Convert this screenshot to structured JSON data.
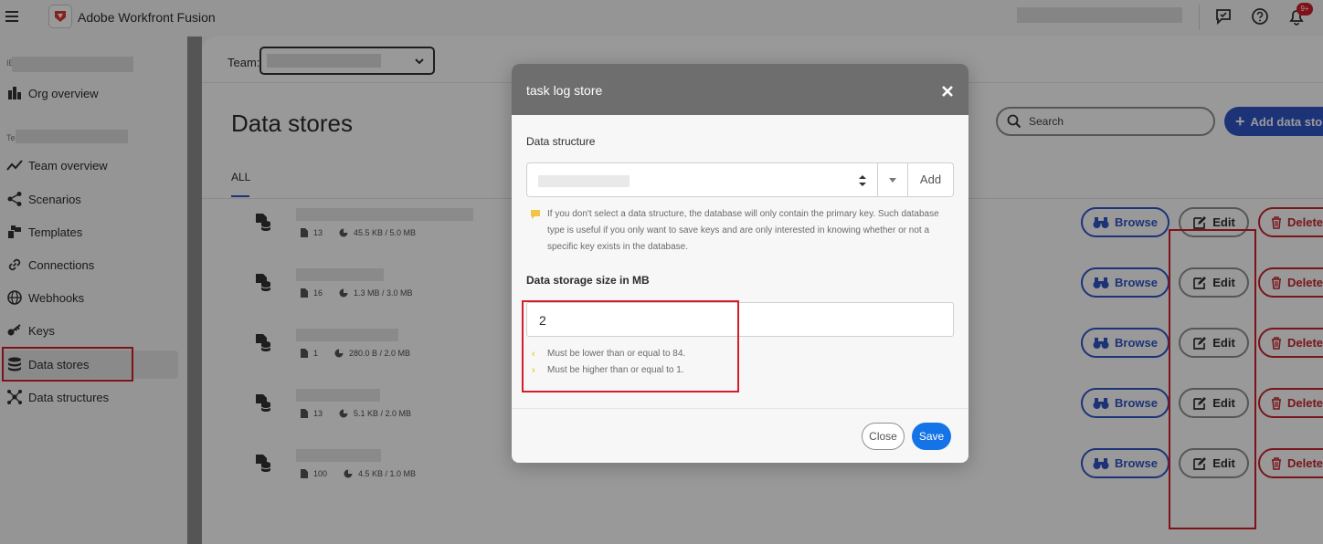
{
  "app": {
    "title": "Adobe Workfront Fusion",
    "notification_badge": "9+"
  },
  "sidebar": {
    "items": [
      {
        "label": "Org overview",
        "icon": "org-chart-icon"
      },
      {
        "label": "Team overview",
        "icon": "trend-line-icon"
      },
      {
        "label": "Scenarios",
        "icon": "share-nodes-icon"
      },
      {
        "label": "Templates",
        "icon": "templates-icon"
      },
      {
        "label": "Connections",
        "icon": "link-icon"
      },
      {
        "label": "Webhooks",
        "icon": "globe-icon"
      },
      {
        "label": "Keys",
        "icon": "key-icon"
      },
      {
        "label": "Data stores",
        "icon": "database-icon",
        "active": true
      },
      {
        "label": "Data structures",
        "icon": "structure-icon"
      }
    ]
  },
  "header": {
    "team_label": "Team:"
  },
  "page": {
    "title": "Data stores",
    "tab_all": "ALL",
    "search_placeholder": "Search",
    "add_button": "Add data sto"
  },
  "rows": [
    {
      "records": "13",
      "size": "45.5 KB / 5.0 MB"
    },
    {
      "records": "16",
      "size": "1.3 MB / 3.0 MB"
    },
    {
      "records": "1",
      "size": "280.0 B / 2.0 MB"
    },
    {
      "records": "13",
      "size": "5.1 KB / 2.0 MB"
    },
    {
      "records": "100",
      "size": "4.5 KB / 1.0 MB"
    }
  ],
  "row_actions": {
    "browse": "Browse",
    "edit": "Edit",
    "delete": "Delete"
  },
  "modal": {
    "title": "task log store",
    "data_structure_label": "Data structure",
    "add_button": "Add",
    "hint": "If you don't select a data structure, the database will only contain the primary key. Such database type is useful if you only want to save keys and are only interested in knowing whether or not a specific key exists in the database.",
    "storage_label": "Data storage size in MB",
    "storage_value": "2",
    "validation_max": "Must be lower than or equal to 84.",
    "validation_min": "Must be higher than or equal to 1.",
    "close_button": "Close",
    "save_button": "Save"
  },
  "colors": {
    "accent_blue": "#2f55c8",
    "save_blue": "#1473e6",
    "delete_red": "#c9252d",
    "annotation_red": "#d31f28"
  }
}
